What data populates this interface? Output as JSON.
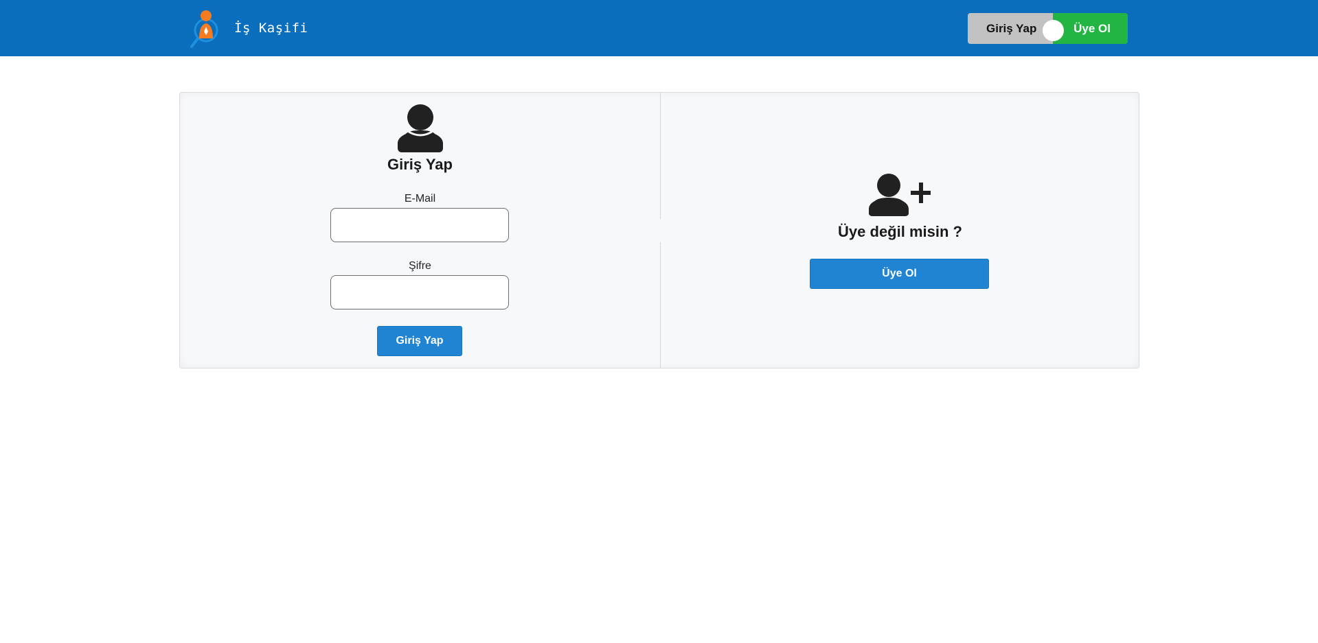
{
  "header": {
    "brand_name": "İş Kaşifi",
    "logo_icon": "magnifier-person-logo",
    "toggle": {
      "login_label": "Giriş Yap",
      "signup_label": "Üye Ol",
      "active": "signup"
    }
  },
  "login": {
    "icon": "user-icon",
    "title": "Giriş Yap",
    "email_label": "E-Mail",
    "email_value": "",
    "password_label": "Şifre",
    "password_value": "",
    "submit_label": "Giriş Yap"
  },
  "signup": {
    "icon": "user-plus-icon",
    "title": "Üye değil misin ?",
    "button_label": "Üye Ol"
  },
  "colors": {
    "header_bg": "#0a6ebd",
    "primary_button": "#2184d2",
    "toggle_active": "#22b543",
    "toggle_inactive": "#c2c2c2",
    "logo_orange": "#f47b20",
    "logo_blue": "#1e90e0"
  }
}
